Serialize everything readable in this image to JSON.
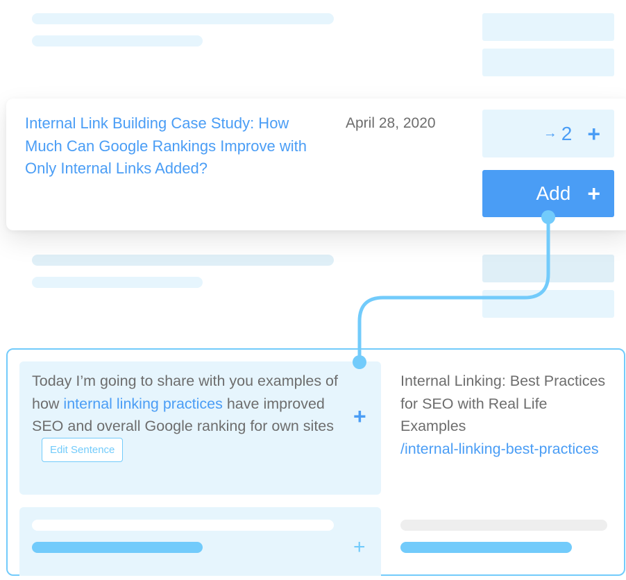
{
  "top_row": {
    "placeholder": true
  },
  "selected_post": {
    "title": "Internal Link Building Case Study: How Much Can Google Rankings Improve with Only Internal Links Added?",
    "date": "April 28, 2020",
    "link_count": "2",
    "arrow_icon": "→",
    "plus_icon": "+",
    "add_button_label": "Add"
  },
  "suggestion": {
    "sentence_before": "Today I’m going to share with you examples of how ",
    "anchor_text": "internal linking practices",
    "sentence_after": " have improved SEO and overall Google ranking for own sites",
    "edit_button_label": "Edit Sentence",
    "plus_icon": "+",
    "target_title": "Internal Linking: Best Practices for SEO with Real Life Examples",
    "target_url": "/internal-linking-best-practices"
  },
  "second_suggestion": {
    "plus_icon": "+"
  },
  "colors": {
    "accent_blue": "#4a9df5",
    "light_blue": "#72cbfb",
    "pale_blue": "#e6f5fd",
    "text_grey": "#6d6d6d"
  }
}
